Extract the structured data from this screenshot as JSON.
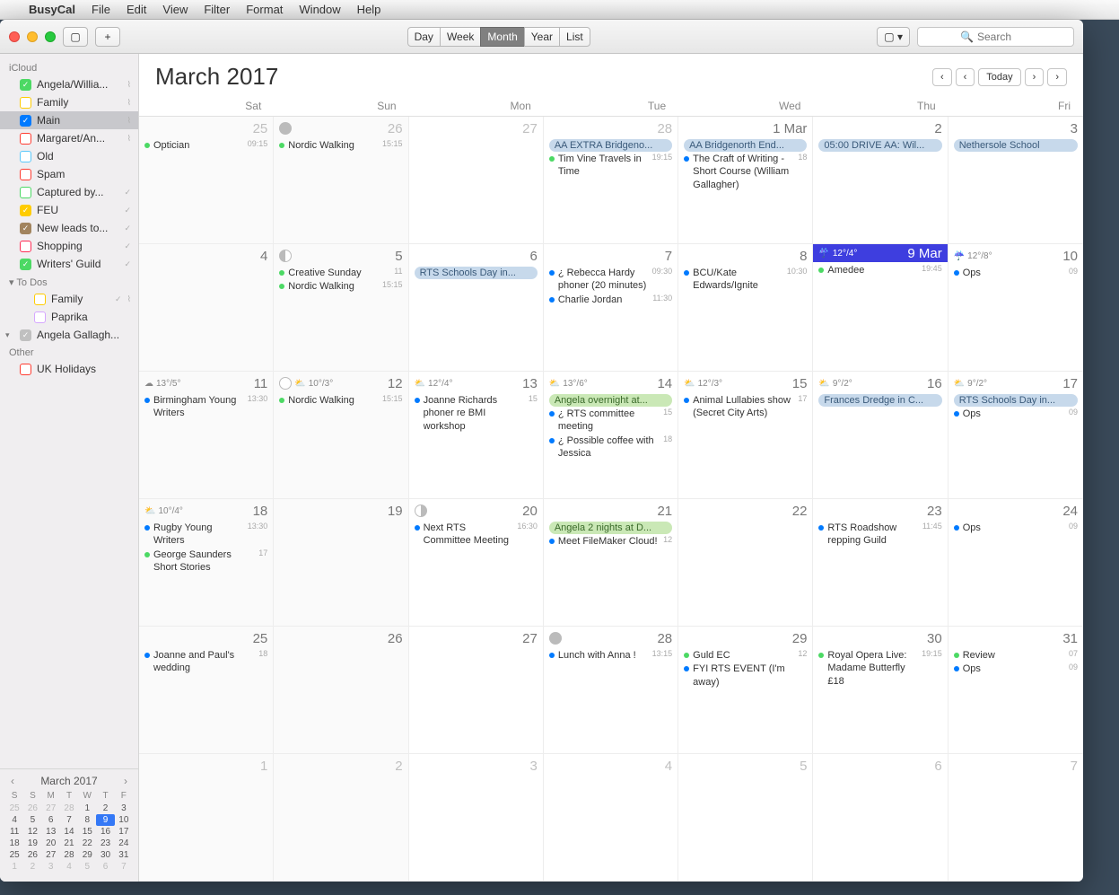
{
  "menubar": {
    "app": "BusyCal",
    "items": [
      "File",
      "Edit",
      "View",
      "Filter",
      "Format",
      "Window",
      "Help"
    ]
  },
  "toolbar": {
    "views": [
      "Day",
      "Week",
      "Month",
      "Year",
      "List"
    ],
    "selected": "Month",
    "search_placeholder": "Search"
  },
  "sidebar": {
    "groups": [
      {
        "title": "iCloud",
        "items": [
          {
            "color": "#4cd964",
            "checked": true,
            "label": "Angela/Willia...",
            "wifi": true
          },
          {
            "color": "#ffcc00",
            "checked": false,
            "label": "Family",
            "wifi": true
          },
          {
            "color": "#007aff",
            "checked": true,
            "label": "Main",
            "wifi": true,
            "selected": true
          },
          {
            "color": "#ff3b30",
            "checked": false,
            "label": "Margaret/An...",
            "wifi": true
          },
          {
            "color": "#5ac8fa",
            "checked": false,
            "label": "Old"
          },
          {
            "color": "#ff3b30",
            "checked": false,
            "label": "Spam"
          },
          {
            "color": "#4cd964",
            "checked": false,
            "label": "Captured by...",
            "tick": true
          },
          {
            "color": "#ffcc00",
            "checked": true,
            "label": "FEU",
            "tick": true
          },
          {
            "color": "#a2845e",
            "checked": true,
            "label": "New leads to...",
            "tick": true
          },
          {
            "color": "#ff2d55",
            "checked": false,
            "label": "Shopping",
            "tick": true
          },
          {
            "color": "#4cd964",
            "checked": true,
            "label": "Writers' Guild",
            "tick": true
          }
        ]
      },
      {
        "title": "To Dos",
        "disclosure": true,
        "items": [
          {
            "color": "#ffcc00",
            "checked": false,
            "label": "Family",
            "sub": true,
            "tick": true,
            "wifi": true
          },
          {
            "color": "#d6a6ff",
            "checked": false,
            "label": "Paprika",
            "sub": true
          }
        ]
      },
      {
        "title": "",
        "items": [
          {
            "color": "#c0c0c0",
            "checked": true,
            "checkgrey": true,
            "label": "Angela Gallagh...",
            "disclosure": true
          }
        ]
      },
      {
        "title": "Other",
        "items": [
          {
            "color": "#ff3b30",
            "checked": false,
            "label": "UK Holidays"
          }
        ]
      }
    ]
  },
  "mini_cal": {
    "title": "March 2017",
    "dow": [
      "S",
      "S",
      "M",
      "T",
      "W",
      "T",
      "F"
    ],
    "weeks": [
      [
        {
          "d": 25,
          "o": 1
        },
        {
          "d": 26,
          "o": 1
        },
        {
          "d": 27,
          "o": 1
        },
        {
          "d": 28,
          "o": 1
        },
        {
          "d": 1
        },
        {
          "d": 2
        },
        {
          "d": 3
        }
      ],
      [
        {
          "d": 4
        },
        {
          "d": 5
        },
        {
          "d": 6
        },
        {
          "d": 7
        },
        {
          "d": 8
        },
        {
          "d": 9,
          "t": 1
        },
        {
          "d": 10
        }
      ],
      [
        {
          "d": 11
        },
        {
          "d": 12
        },
        {
          "d": 13
        },
        {
          "d": 14
        },
        {
          "d": 15
        },
        {
          "d": 16
        },
        {
          "d": 17
        }
      ],
      [
        {
          "d": 18
        },
        {
          "d": 19
        },
        {
          "d": 20
        },
        {
          "d": 21
        },
        {
          "d": 22
        },
        {
          "d": 23
        },
        {
          "d": 24
        }
      ],
      [
        {
          "d": 25
        },
        {
          "d": 26
        },
        {
          "d": 27
        },
        {
          "d": 28
        },
        {
          "d": 29
        },
        {
          "d": 30
        },
        {
          "d": 31
        }
      ],
      [
        {
          "d": 1,
          "o": 1
        },
        {
          "d": 2,
          "o": 1
        },
        {
          "d": 3,
          "o": 1
        },
        {
          "d": 4,
          "o": 1
        },
        {
          "d": 5,
          "o": 1
        },
        {
          "d": 6,
          "o": 1
        },
        {
          "d": 7,
          "o": 1
        }
      ]
    ]
  },
  "main": {
    "title_month": "March",
    "title_year": "2017",
    "today_btn": "Today",
    "dow": [
      "Sat",
      "Sun",
      "Mon",
      "Tue",
      "Wed",
      "Thu",
      "Fri"
    ],
    "weeks": [
      [
        {
          "num": "25",
          "out": true,
          "events": [
            {
              "type": "dot",
              "color": "#4cd964",
              "text": "Optician",
              "time": "09:15"
            }
          ]
        },
        {
          "num": "26",
          "out": true,
          "moon": "full",
          "events": [
            {
              "type": "dot",
              "color": "#4cd964",
              "text": "Nordic Walking",
              "time": "15:15"
            }
          ]
        },
        {
          "num": "27",
          "out": true,
          "events": []
        },
        {
          "num": "28",
          "out": true,
          "events": [
            {
              "type": "bar",
              "barclass": "bar-blue",
              "text": "AA EXTRA Bridgeno..."
            },
            {
              "type": "dot",
              "color": "#4cd964",
              "text": "Tim Vine Travels in Time",
              "time": "19:15"
            }
          ]
        },
        {
          "num": "1 Mar",
          "events": [
            {
              "type": "bar",
              "barclass": "bar-blue",
              "text": "AA Bridgenorth End..."
            },
            {
              "type": "dot",
              "color": "#007aff",
              "text": "The Craft of Writing - Short Course (William Gallagher)",
              "time": "18"
            }
          ]
        },
        {
          "num": "2",
          "events": [
            {
              "type": "bar",
              "barclass": "bar-blue",
              "text": "05:00 DRIVE AA: Wil..."
            }
          ]
        },
        {
          "num": "3",
          "events": [
            {
              "type": "bar",
              "barclass": "bar-blue",
              "text": "Nethersole School"
            }
          ]
        }
      ],
      [
        {
          "num": "4",
          "events": []
        },
        {
          "num": "5",
          "moon": "half",
          "events": [
            {
              "type": "dot",
              "color": "#4cd964",
              "text": "Creative Sunday",
              "time": "11"
            },
            {
              "type": "dot",
              "color": "#4cd964",
              "text": "Nordic Walking",
              "time": "15:15"
            }
          ]
        },
        {
          "num": "6",
          "events": [
            {
              "type": "bar",
              "barclass": "bar-blue",
              "text": "RTS Schools Day in..."
            }
          ]
        },
        {
          "num": "7",
          "events": [
            {
              "type": "dot",
              "color": "#007aff",
              "text": "¿ Rebecca Hardy phoner (20 minutes)",
              "time": "09:30"
            },
            {
              "type": "dot",
              "color": "#007aff",
              "text": "Charlie Jordan",
              "time": "11:30"
            }
          ]
        },
        {
          "num": "8",
          "events": [
            {
              "type": "dot",
              "color": "#007aff",
              "text": "BCU/Kate Edwards/Ignite",
              "time": "10:30"
            }
          ]
        },
        {
          "num": "9 Mar",
          "today": true,
          "weather": "12°/4°",
          "wicon": "rain",
          "events": [
            {
              "type": "dot",
              "color": "#4cd964",
              "text": "Amedee",
              "time": "19:45"
            }
          ]
        },
        {
          "num": "10",
          "weather": "12°/8°",
          "wicon": "rain",
          "events": [
            {
              "type": "dot",
              "color": "#007aff",
              "text": "Ops",
              "time": "09"
            }
          ]
        }
      ],
      [
        {
          "num": "11",
          "weather": "13°/5°",
          "wicon": "cloud",
          "events": [
            {
              "type": "dot",
              "color": "#007aff",
              "text": "Birmingham Young Writers",
              "time": "13:30"
            }
          ]
        },
        {
          "num": "12",
          "weather": "10°/3°",
          "wicon": "sun",
          "moon": "ring",
          "events": [
            {
              "type": "dot",
              "color": "#4cd964",
              "text": "Nordic Walking",
              "time": "15:15"
            }
          ]
        },
        {
          "num": "13",
          "weather": "12°/4°",
          "wicon": "sun",
          "events": [
            {
              "type": "dot",
              "color": "#007aff",
              "text": "Joanne Richards phoner re BMI workshop",
              "time": "15"
            }
          ]
        },
        {
          "num": "14",
          "weather": "13°/6°",
          "wicon": "sun",
          "events": [
            {
              "type": "bar",
              "barclass": "bar-green",
              "text": "Angela overnight at..."
            },
            {
              "type": "dot",
              "color": "#007aff",
              "text": "¿ RTS committee meeting",
              "time": "15"
            },
            {
              "type": "dot",
              "color": "#007aff",
              "text": "¿ Possible coffee with Jessica",
              "time": "18"
            }
          ]
        },
        {
          "num": "15",
          "weather": "12°/3°",
          "wicon": "sun",
          "events": [
            {
              "type": "dot",
              "color": "#007aff",
              "text": "Animal Lullabies show (Secret City Arts)",
              "time": "17"
            }
          ]
        },
        {
          "num": "16",
          "weather": "9°/2°",
          "wicon": "sun",
          "events": [
            {
              "type": "bar",
              "barclass": "bar-blue",
              "text": "Frances Dredge in C..."
            }
          ]
        },
        {
          "num": "17",
          "weather": "9°/2°",
          "wicon": "sun",
          "events": [
            {
              "type": "bar",
              "barclass": "bar-blue",
              "text": "RTS Schools Day in..."
            },
            {
              "type": "dot",
              "color": "#007aff",
              "text": "Ops",
              "time": "09"
            }
          ]
        }
      ],
      [
        {
          "num": "18",
          "weather": "10°/4°",
          "wicon": "sun",
          "events": [
            {
              "type": "dot",
              "color": "#007aff",
              "text": "Rugby Young Writers",
              "time": "13:30"
            },
            {
              "type": "dot",
              "color": "#4cd964",
              "text": "George Saunders Short Stories",
              "time": "17"
            }
          ]
        },
        {
          "num": "19",
          "events": []
        },
        {
          "num": "20",
          "moon": "halfR",
          "events": [
            {
              "type": "dot",
              "color": "#007aff",
              "text": "Next RTS Committee Meeting",
              "time": "16:30"
            }
          ]
        },
        {
          "num": "21",
          "events": [
            {
              "type": "bar",
              "barclass": "bar-green",
              "text": "Angela 2 nights at D..."
            },
            {
              "type": "dot",
              "color": "#007aff",
              "text": "Meet FileMaker Cloud!",
              "time": "12"
            }
          ]
        },
        {
          "num": "22",
          "events": []
        },
        {
          "num": "23",
          "events": [
            {
              "type": "dot",
              "color": "#007aff",
              "text": "RTS Roadshow repping Guild",
              "time": "11:45"
            }
          ]
        },
        {
          "num": "24",
          "events": [
            {
              "type": "dot",
              "color": "#007aff",
              "text": "Ops",
              "time": "09"
            }
          ]
        }
      ],
      [
        {
          "num": "25",
          "events": [
            {
              "type": "dot",
              "color": "#007aff",
              "text": "Joanne and Paul's wedding",
              "time": "18"
            }
          ]
        },
        {
          "num": "26",
          "events": []
        },
        {
          "num": "27",
          "events": []
        },
        {
          "num": "28",
          "moon": "full",
          "events": [
            {
              "type": "dot",
              "color": "#007aff",
              "text": "Lunch with Anna !",
              "time": "13:15"
            }
          ]
        },
        {
          "num": "29",
          "events": [
            {
              "type": "dot",
              "color": "#4cd964",
              "text": "Guld EC",
              "time": "12"
            },
            {
              "type": "dot",
              "color": "#007aff",
              "text": "FYI RTS EVENT (I'm away)"
            }
          ]
        },
        {
          "num": "30",
          "events": [
            {
              "type": "dot",
              "color": "#4cd964",
              "text": "Royal Opera Live: Madame Butterfly £18",
              "time": "19:15"
            }
          ]
        },
        {
          "num": "31",
          "events": [
            {
              "type": "dot",
              "color": "#4cd964",
              "text": "Review",
              "time": "07"
            },
            {
              "type": "dot",
              "color": "#007aff",
              "text": "Ops",
              "time": "09"
            }
          ]
        }
      ],
      [
        {
          "num": "1",
          "out": true,
          "events": []
        },
        {
          "num": "2",
          "out": true,
          "events": []
        },
        {
          "num": "3",
          "out": true,
          "events": []
        },
        {
          "num": "4",
          "out": true,
          "events": []
        },
        {
          "num": "5",
          "out": true,
          "events": []
        },
        {
          "num": "6",
          "out": true,
          "events": []
        },
        {
          "num": "7",
          "out": true,
          "events": []
        }
      ]
    ]
  }
}
